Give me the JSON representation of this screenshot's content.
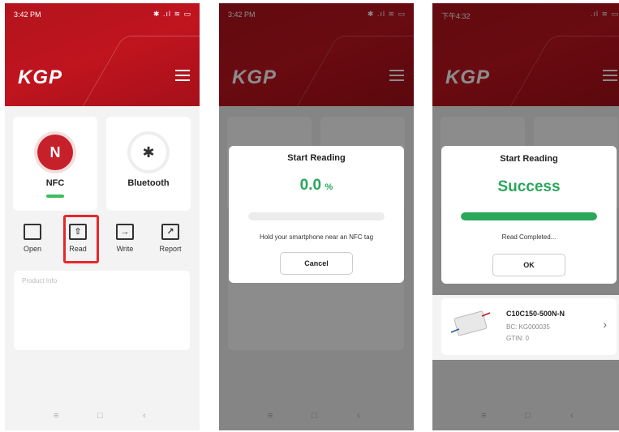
{
  "screen1": {
    "status_time": "3:42 PM",
    "status_tray": "✱ .ıl ≋ ▭",
    "logo": "KGP",
    "tiles": [
      {
        "label": "NFC",
        "icon": "nfc-icon",
        "glyph": "N"
      },
      {
        "label": "Bluetooth",
        "icon": "bluetooth-icon",
        "glyph": "✱"
      }
    ],
    "actions": [
      {
        "label": "Open",
        "icon": "folder-icon",
        "glyph": ""
      },
      {
        "label": "Read",
        "icon": "upload-icon",
        "glyph": "⇧"
      },
      {
        "label": "Write",
        "icon": "import-icon",
        "glyph": "→"
      },
      {
        "label": "Report",
        "icon": "chart-icon",
        "glyph": "↗"
      }
    ],
    "product_info_label": "Product Info",
    "nav": {
      "menu": "≡",
      "home": "□",
      "back": "‹"
    }
  },
  "screen2": {
    "status_time": "3:42 PM",
    "status_tray": "✱ .ıl ≋ ▭",
    "logo": "KGP",
    "dialog": {
      "title": "Start Reading",
      "percent_value": "0.0",
      "percent_sign": "%",
      "progress": 0,
      "hint": "Hold your smartphone near an NFC tag",
      "button": "Cancel"
    },
    "nav": {
      "menu": "≡",
      "home": "□",
      "back": "‹"
    }
  },
  "screen3": {
    "status_time": "下午4:32",
    "status_tray": ".ıl ≋ ▭",
    "logo": "KGP",
    "dialog": {
      "title": "Start Reading",
      "result": "Success",
      "progress": 1.0,
      "hint": "Read Completed...",
      "button": "OK"
    },
    "product": {
      "name": "C10C150-500N-N",
      "bc": "BC: KG000035",
      "gtin": "GTIN: 0",
      "chevron": "›"
    },
    "nav": {
      "menu": "≡",
      "home": "□",
      "back": "‹"
    }
  },
  "colors": {
    "brand_red": "#c0141f",
    "success_green": "#2aa75a",
    "highlight_red": "#e8262a"
  }
}
